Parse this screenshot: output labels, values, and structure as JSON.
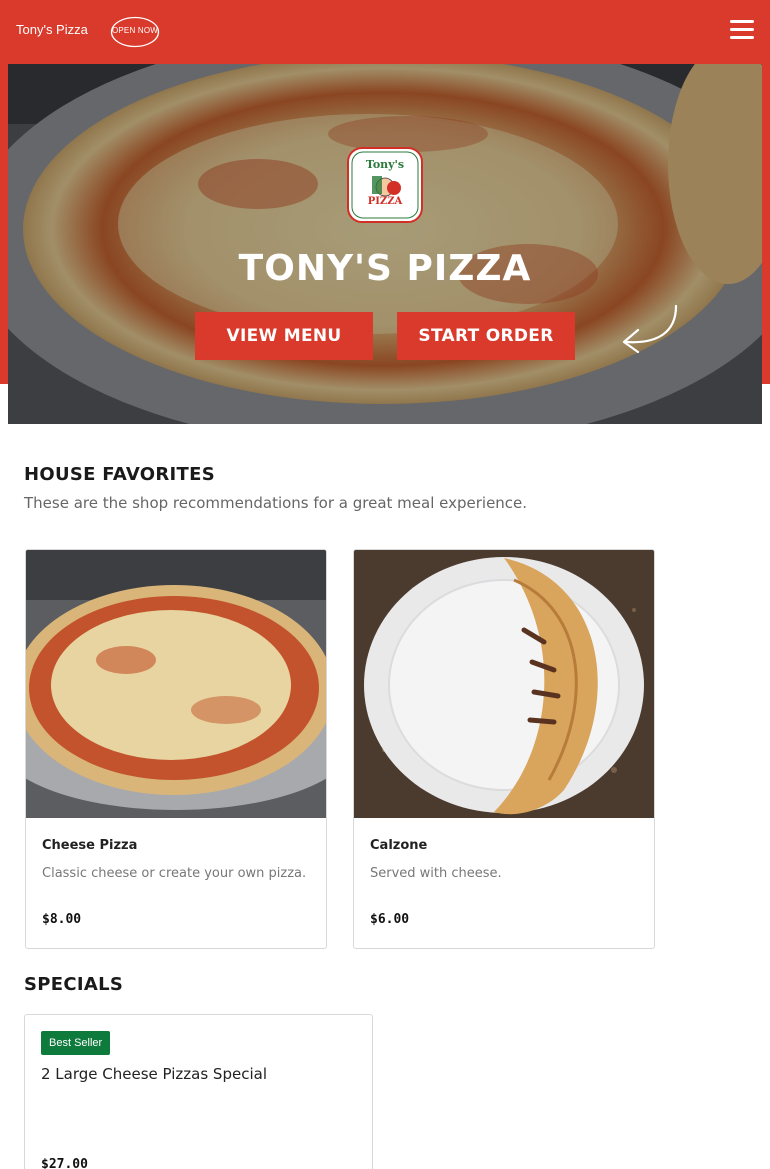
{
  "header": {
    "brand": "Tony's Pizza",
    "open_badge": "OPEN NOW",
    "menu_icon": "hamburger-menu-icon"
  },
  "hero": {
    "logo_line1": "Tony's",
    "logo_line2": "PIZZA",
    "title": "TONY'S PIZZA",
    "view_menu_label": "VIEW MENU",
    "start_order_label": "START ORDER",
    "arrow_icon": "curved-arrow-icon"
  },
  "favorites": {
    "title": "HOUSE FAVORITES",
    "subtitle": "These are the shop recommendations for a great meal experience.",
    "items": [
      {
        "name": "Cheese Pizza",
        "description": "Classic cheese or create your own pizza.",
        "price": "$8.00"
      },
      {
        "name": "Calzone",
        "description": "Served with cheese.",
        "price": "$6.00"
      }
    ]
  },
  "specials": {
    "title": "SPECIALS",
    "items": [
      {
        "badge": "Best Seller",
        "name": "2 Large Cheese Pizzas Special",
        "price": "$27.00"
      }
    ]
  },
  "colors": {
    "brand_red": "#d93a2b",
    "badge_green": "#0e7a3c"
  }
}
